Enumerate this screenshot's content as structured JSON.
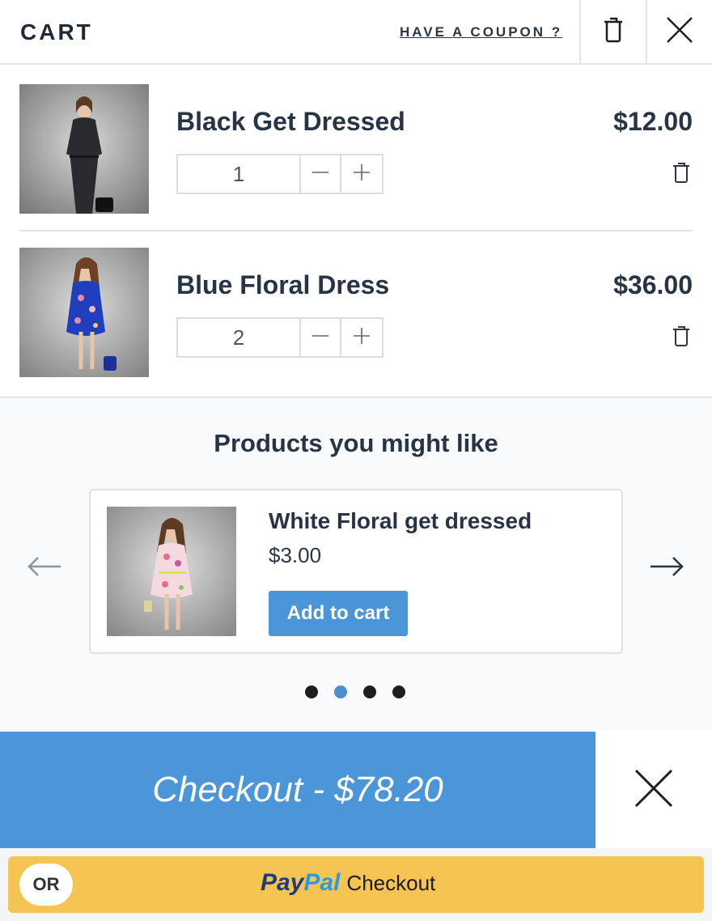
{
  "header": {
    "title": "CART",
    "coupon_label": "HAVE A COUPON ?"
  },
  "cart_items": [
    {
      "name": "Black Get Dressed",
      "price": "$12.00",
      "quantity": "1"
    },
    {
      "name": "Blue Floral Dress",
      "price": "$36.00",
      "quantity": "2"
    }
  ],
  "recommendations": {
    "title": "Products you might like",
    "product": {
      "name": "White Floral get dressed",
      "price": "$3.00",
      "button_label": "Add to cart"
    },
    "pagination": {
      "total": 4,
      "active_index": 1
    }
  },
  "checkout": {
    "label": "Checkout - $78.20"
  },
  "paypal": {
    "or_label": "OR",
    "brand_pay": "Pay",
    "brand_pal": "Pal",
    "checkout_label": "Checkout"
  },
  "icons": {
    "trash": "trash-icon",
    "close": "close-icon",
    "minus": "minus-icon",
    "plus": "plus-icon",
    "arrow_left": "arrow-left-icon",
    "arrow_right": "arrow-right-icon"
  },
  "colors": {
    "accent": "#4a96d9",
    "paypal_yellow": "#f6c453",
    "text_dark": "#263445",
    "active_dot": "#4a8fd0"
  }
}
